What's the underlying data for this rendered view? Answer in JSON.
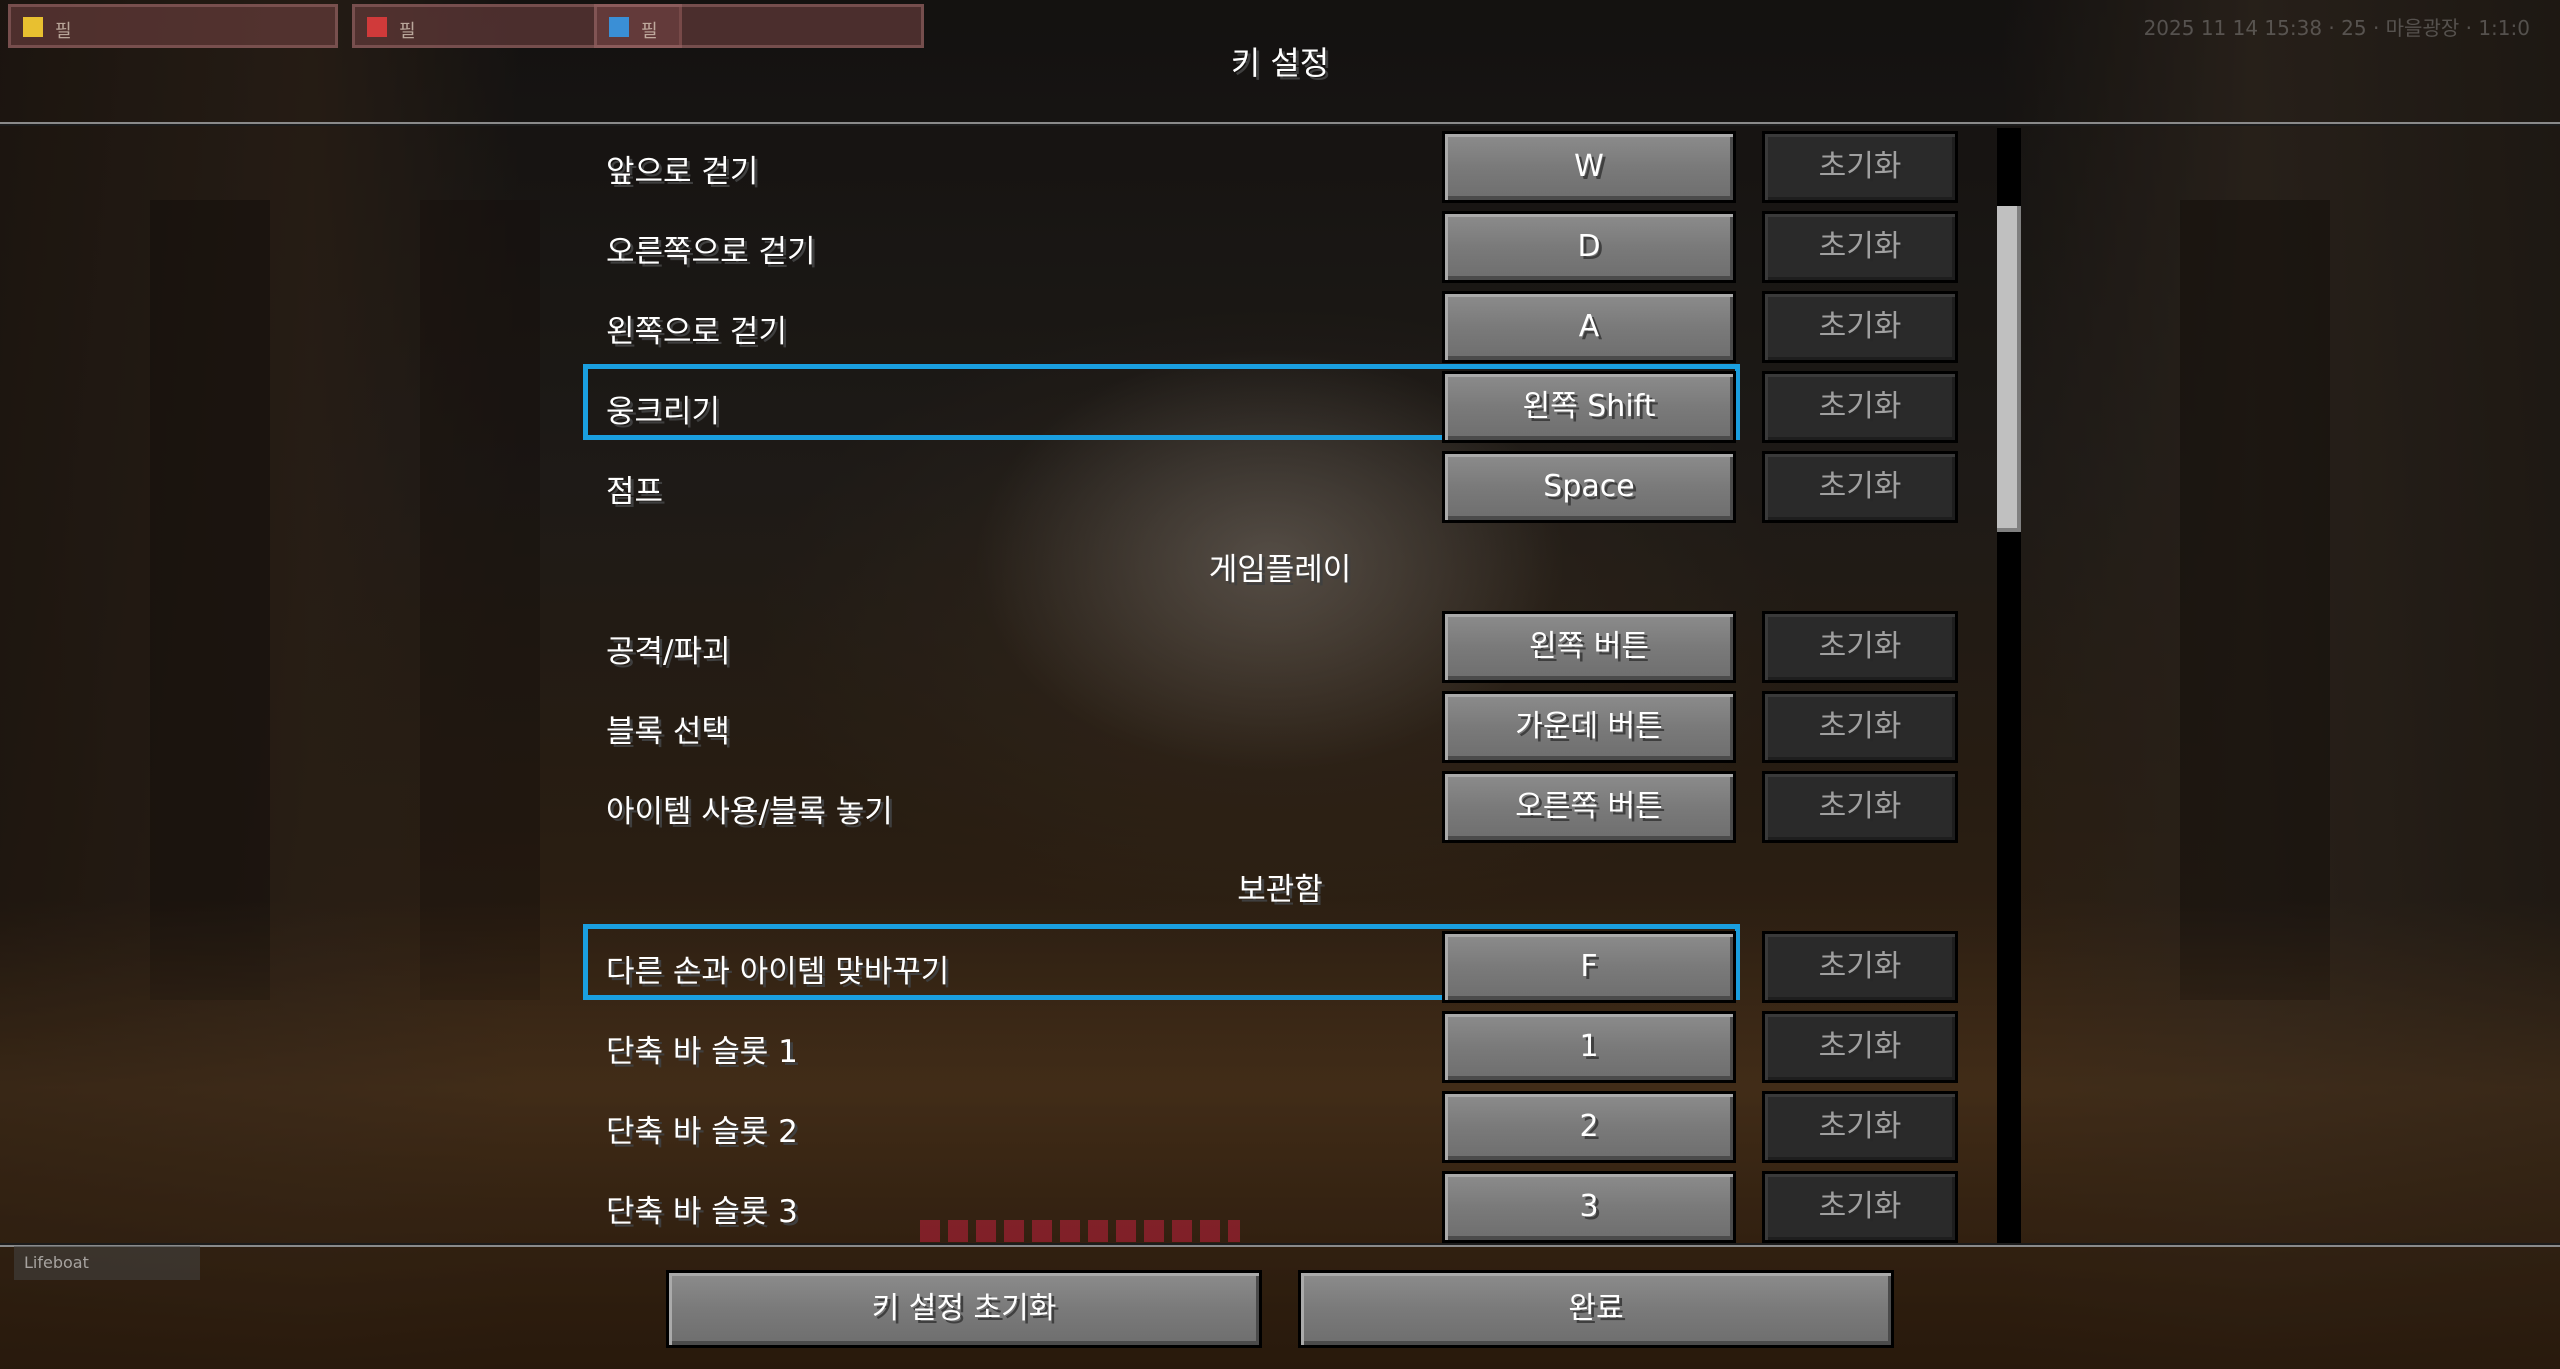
{
  "screen": {
    "title": "키 설정"
  },
  "hud": {
    "slots": [
      "필",
      "필",
      "필"
    ],
    "slot_colors": [
      "#e8c030",
      "#d03a3a",
      "#3a8fd6"
    ],
    "right_text": "2025 11 14 15:38 · 25 · 마을광장 · 1:1:0",
    "bottom_left": "Lifeboat"
  },
  "colors": {
    "highlight": "#1a9fe0",
    "text": "#ffffff"
  },
  "reset_label": "초기화",
  "rows": [
    {
      "action": "앞으로 걷기",
      "key": "W"
    },
    {
      "action": "오른쪽으로 걷기",
      "key": "D"
    },
    {
      "action": "왼쪽으로 걷기",
      "key": "A"
    },
    {
      "action": "웅크리기",
      "key": "왼쪽 Shift",
      "highlighted": true
    },
    {
      "action": "점프",
      "key": "Space"
    }
  ],
  "categories": {
    "gameplay": "게임플레이",
    "inventory": "보관함"
  },
  "gameplay_rows": [
    {
      "action": "공격/파괴",
      "key": "왼쪽 버튼"
    },
    {
      "action": "블록 선택",
      "key": "가운데 버튼"
    },
    {
      "action": "아이템 사용/블록 놓기",
      "key": "오른쪽 버튼"
    }
  ],
  "inventory_rows": [
    {
      "action": "다른 손과 아이템 맞바꾸기",
      "key": "F",
      "highlighted": true
    },
    {
      "action": "단축 바 슬롯 1",
      "key": "1"
    },
    {
      "action": "단축 바 슬롯 2",
      "key": "2"
    },
    {
      "action": "단축 바 슬롯 3",
      "key": "3"
    }
  ],
  "footer": {
    "reset_all_label": "키 설정 초기화",
    "done_label": "완료"
  }
}
